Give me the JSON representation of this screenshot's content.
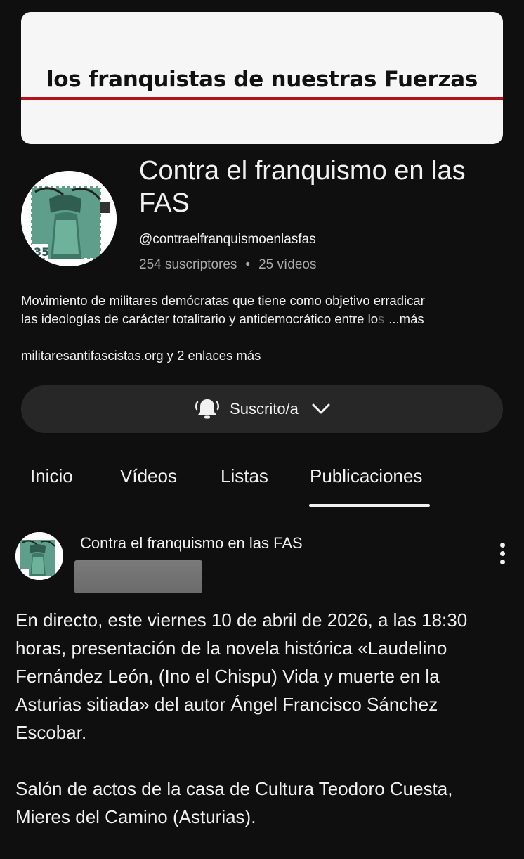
{
  "banner": {
    "text": "los franquistas de nuestras Fuerzas"
  },
  "channel": {
    "name": "Contra el franquismo en las FAS",
    "handle": "@contraelfranquismoenlasfas",
    "subscribers": "254 suscriptores",
    "separator": "•",
    "videos": "25 vídeos",
    "description_line1": "Movimiento de militares demócratas que tiene como objetivo erradicar",
    "description_line2": "las ideologías de carácter totalitario y antidemocrático entre lo",
    "description_fade": "s",
    "description_more": "...más",
    "link_main": "militaresantifascistas.org",
    "link_more": " y 2 enlaces más",
    "avatar_stamp_value": "35"
  },
  "subscribe_button": {
    "label": "Suscrito/a",
    "bell_icon": "bell-ringing-icon",
    "chevron_icon": "chevron-down-icon"
  },
  "tabs": [
    {
      "label": "Inicio"
    },
    {
      "label": "Vídeos"
    },
    {
      "label": "Listas"
    },
    {
      "label": "Publicaciones",
      "active": true
    }
  ],
  "post": {
    "author": "Contra el franquismo en las FAS",
    "paragraph1": "En directo, este viernes 10 de abril de 2026, a las 18:30 horas, presentación de la novela histórica «Laudelino Fernández León, (Ino el Chispu) Vida y muerte en la Asturias sitiada» del autor Ángel Francisco Sánchez Escobar.",
    "paragraph2": "Salón de actos de la casa de Cultura Teodoro Cuesta, Mieres del Camino (Asturias)."
  },
  "colors": {
    "background": "#0f0f0f",
    "accent_line": "#b3141b",
    "button_bg": "#272727",
    "stamp_green": "#5f9e8a"
  }
}
